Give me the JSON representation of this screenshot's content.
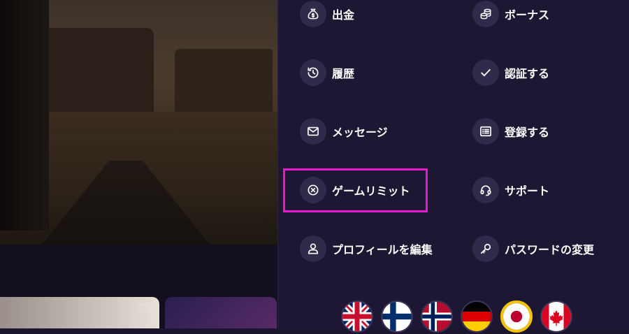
{
  "menu": {
    "items": [
      {
        "label": "出金",
        "icon": "money-bag-icon"
      },
      {
        "label": "ボーナス",
        "icon": "coins-icon"
      },
      {
        "label": "履歴",
        "icon": "history-icon"
      },
      {
        "label": "認証する",
        "icon": "checkmark-icon"
      },
      {
        "label": "メッセージ",
        "icon": "envelope-icon"
      },
      {
        "label": "登録する",
        "icon": "list-icon"
      },
      {
        "label": "ゲームリミット",
        "icon": "circle-x-icon"
      },
      {
        "label": "サポート",
        "icon": "headset-icon"
      },
      {
        "label": "プロフィールを編集",
        "icon": "user-icon"
      },
      {
        "label": "パスワードの変更",
        "icon": "key-icon"
      }
    ],
    "highlighted_item": "ゲームリミット"
  },
  "languages": [
    {
      "name": "English",
      "flag": "uk-flag-icon",
      "selected": false
    },
    {
      "name": "Finnish",
      "flag": "finland-flag-icon",
      "selected": false
    },
    {
      "name": "Norwegian",
      "flag": "norway-flag-icon",
      "selected": false
    },
    {
      "name": "German",
      "flag": "germany-flag-icon",
      "selected": false
    },
    {
      "name": "Japanese",
      "flag": "japan-flag-icon",
      "selected": true
    },
    {
      "name": "Canadian",
      "flag": "canada-flag-icon",
      "selected": false
    }
  ],
  "colors": {
    "panel_bg": "#1e1733",
    "icon_circle": "#322a4a",
    "highlight_border": "#e51bd4",
    "selected_flag_border": "#f5c400"
  }
}
